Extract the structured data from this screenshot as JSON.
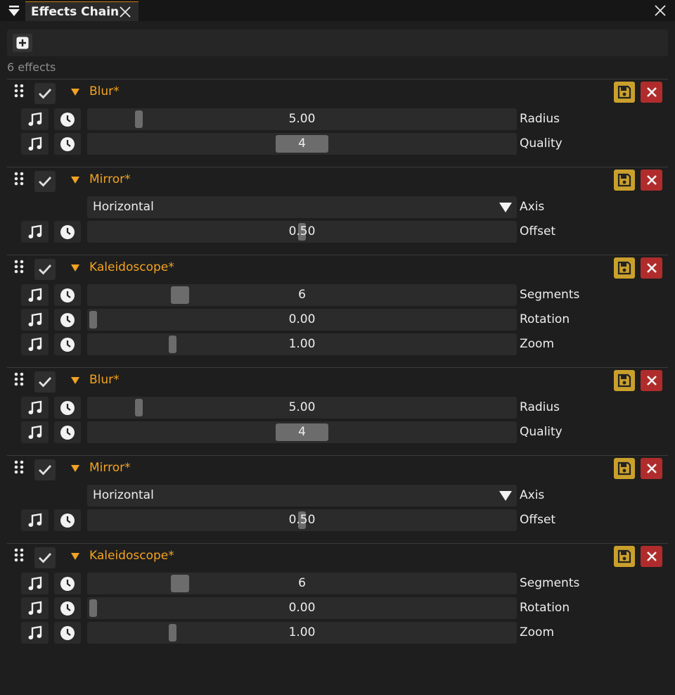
{
  "window": {
    "tab_title": "Effects Chain",
    "icons": {
      "menu": "triangle-down-icon",
      "tab_close": "close-icon",
      "window_close": "close-icon"
    }
  },
  "toolbar": {
    "add_icon": "plus-icon"
  },
  "effect_count": "6 effects",
  "colors": {
    "accent_orange": "#f3a321",
    "save_yellow": "#caa02c",
    "delete_red": "#b02c2c",
    "tab_border": "#c77a12"
  },
  "effects": [
    {
      "name": "Blur*",
      "enabled": true,
      "params": [
        {
          "type": "slider",
          "label": "Radius",
          "value": "5.00",
          "fill": 0.11,
          "thumb": "small"
        },
        {
          "type": "slider",
          "label": "Quality",
          "value": "4",
          "fill": 0.5,
          "thumb": "wide"
        }
      ]
    },
    {
      "name": "Mirror*",
      "enabled": true,
      "params": [
        {
          "type": "select",
          "label": "Axis",
          "value": "Horizontal"
        },
        {
          "type": "slider",
          "label": "Offset",
          "value": "0.50",
          "fill": 0.5,
          "thumb": "small"
        }
      ]
    },
    {
      "name": "Kaleidoscope*",
      "enabled": true,
      "params": [
        {
          "type": "slider",
          "label": "Segments",
          "value": "6",
          "fill": 0.2,
          "thumb": "medium"
        },
        {
          "type": "slider",
          "label": "Rotation",
          "value": "0.00",
          "fill": 0.0,
          "thumb": "small"
        },
        {
          "type": "slider",
          "label": "Zoom",
          "value": "1.00",
          "fill": 0.19,
          "thumb": "small"
        }
      ]
    },
    {
      "name": "Blur*",
      "enabled": true,
      "params": [
        {
          "type": "slider",
          "label": "Radius",
          "value": "5.00",
          "fill": 0.11,
          "thumb": "small"
        },
        {
          "type": "slider",
          "label": "Quality",
          "value": "4",
          "fill": 0.5,
          "thumb": "wide"
        }
      ]
    },
    {
      "name": "Mirror*",
      "enabled": true,
      "params": [
        {
          "type": "select",
          "label": "Axis",
          "value": "Horizontal"
        },
        {
          "type": "slider",
          "label": "Offset",
          "value": "0.50",
          "fill": 0.5,
          "thumb": "small"
        }
      ]
    },
    {
      "name": "Kaleidoscope*",
      "enabled": true,
      "params": [
        {
          "type": "slider",
          "label": "Segments",
          "value": "6",
          "fill": 0.2,
          "thumb": "medium"
        },
        {
          "type": "slider",
          "label": "Rotation",
          "value": "0.00",
          "fill": 0.0,
          "thumb": "small"
        },
        {
          "type": "slider",
          "label": "Zoom",
          "value": "1.00",
          "fill": 0.19,
          "thumb": "small"
        }
      ]
    }
  ]
}
